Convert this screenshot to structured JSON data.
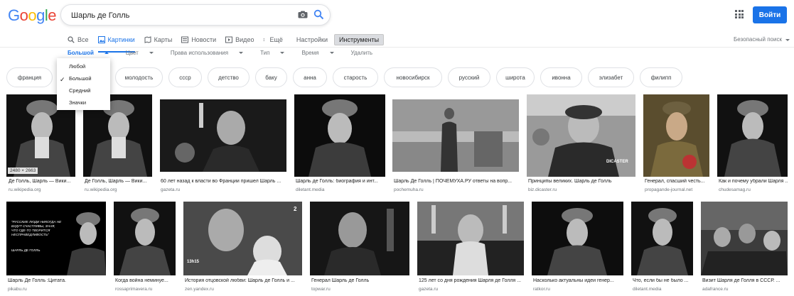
{
  "logo": [
    "G",
    "o",
    "o",
    "g",
    "l",
    "e"
  ],
  "logo_colors": [
    "#4285f4",
    "#ea4335",
    "#fbbc05",
    "#4285f4",
    "#34a853",
    "#ea4335"
  ],
  "search": {
    "query": "Шарль де Голль"
  },
  "signin_label": "Войти",
  "tabs": [
    {
      "label": "Все",
      "icon": "search-icon"
    },
    {
      "label": "Картинки",
      "icon": "image-icon"
    },
    {
      "label": "Карты",
      "icon": "map-icon"
    },
    {
      "label": "Новости",
      "icon": "news-icon"
    },
    {
      "label": "Видео",
      "icon": "video-icon"
    },
    {
      "label": "Ещё",
      "icon": "more-icon"
    },
    {
      "label": "Настройки"
    },
    {
      "label": "Инструменты"
    }
  ],
  "safe_search": "Безопасный поиск",
  "filters": {
    "size": "Большой",
    "color": "Цвет",
    "rights": "Права использования",
    "type": "Тип",
    "time": "Время",
    "clear": "Удалить"
  },
  "size_menu": [
    "Любой",
    "Большой",
    "Средний",
    "Значки"
  ],
  "chips": [
    "франция",
    "",
    "сталин",
    "молодость",
    "ссср",
    "детство",
    "баку",
    "анна",
    "старость",
    "новосибирск",
    "русский",
    "широта",
    "ивонна",
    "элизабет",
    "филипп"
  ],
  "results_row1": [
    {
      "caption": "Де Голль, Шарль — Вики...",
      "source": "ru.wikipedia.org",
      "size": "2480 × 2663"
    },
    {
      "caption": "Де Голль, Шарль — Вики...",
      "source": "ru.wikipedia.org"
    },
    {
      "caption": "60 лет назад к власти во Франции пришел Шарль ...",
      "source": "gazeta.ru"
    },
    {
      "caption": "Шарль де Голль: биография и инт...",
      "source": "diletant.media"
    },
    {
      "caption": "Шарль Де Голль | ПОЧЕМУХА.РУ ответы на вопр...",
      "source": "pochemuha.ru"
    },
    {
      "caption": "Принципы великих. Шарль де Голль",
      "source": "biz.dicaster.ru",
      "watermark": "DICASTER"
    },
    {
      "caption": "Генерал, спасший честь...",
      "source": "propagande-journal.net"
    },
    {
      "caption": "Как и почему убрали Шарля ...",
      "source": "chudesamag.ru"
    }
  ],
  "results_row2": [
    {
      "caption": "Шарль Де Голль :Цитата.",
      "source": "pikabu.ru",
      "quote": "\"РУССКИЕ ЛЮДИ НИКОГДА НЕ БУДУТ СЧАСТЛИВЫ, ЗНАЯ, ЧТО ГДЕ-ТО ТВОРИТСЯ НЕСПРАВЕДЛИВОСТЬ\"",
      "quote_author": "ШАРЛЬ ДЕ ГОЛЛЬ"
    },
    {
      "caption": "Когда война неминуе...",
      "source": "rossaprimavera.ru"
    },
    {
      "caption": "История отцовской любви: Шарль де Голль и ...",
      "source": "zen.yandex.ru",
      "badge": "2",
      "overlay": "13h15"
    },
    {
      "caption": "Генерал Шарль де Голль",
      "source": "topwar.ru"
    },
    {
      "caption": "125 лет со дня рождения Шарля де Голля ...",
      "source": "gazeta.ru"
    },
    {
      "caption": "Насколько актуальны идеи генер...",
      "source": "ratkor.ru"
    },
    {
      "caption": "Что, если бы не было ...",
      "source": "diletant.media"
    },
    {
      "caption": "Визит Шарля де Голля в СССР. ...",
      "source": "adafrance.ru"
    }
  ]
}
